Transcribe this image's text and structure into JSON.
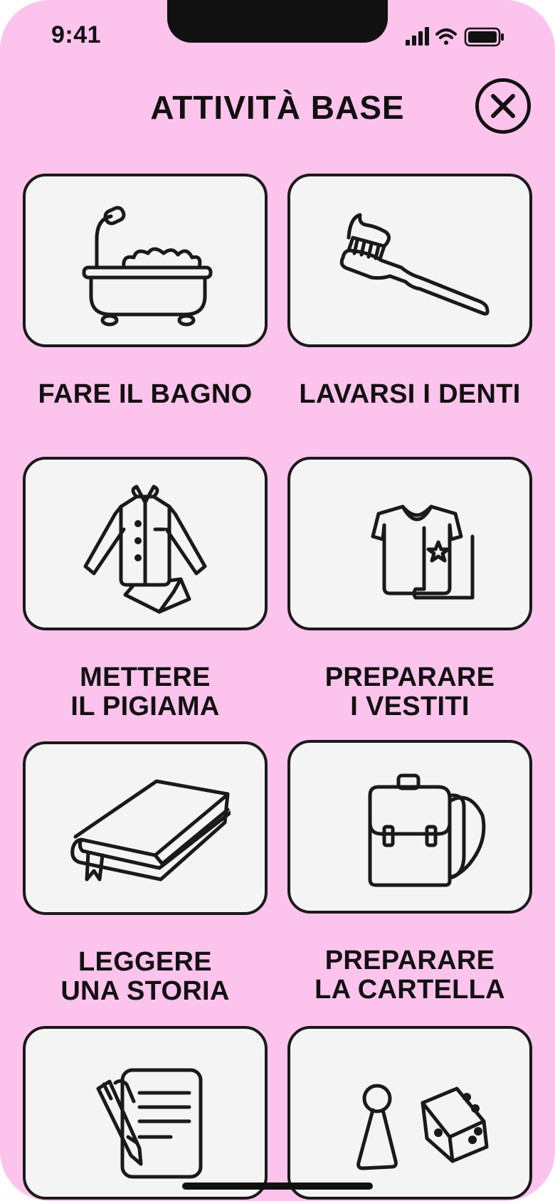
{
  "status_bar": {
    "time": "9:41",
    "icons": [
      "signal-icon",
      "wifi-icon",
      "battery-icon"
    ]
  },
  "header": {
    "title": "ATTIVITÀ BASE",
    "close_icon": "close-icon"
  },
  "activities": [
    {
      "label": "FARE IL BAGNO",
      "icon": "bathtub-icon"
    },
    {
      "label": "LAVARSI I DENTI",
      "icon": "toothbrush-icon"
    },
    {
      "label": "METTERE\nIL PIGIAMA",
      "icon": "pajamas-icon"
    },
    {
      "label": "PREPARARE\nI VESTITI",
      "icon": "clothes-icon"
    },
    {
      "label": "LEGGERE\nUNA STORIA",
      "icon": "book-icon"
    },
    {
      "label": "PREPARARE\nLA CARTELLA",
      "icon": "backpack-icon"
    },
    {
      "label": "",
      "icon": "homework-icon"
    },
    {
      "label": "",
      "icon": "board-game-icon"
    }
  ],
  "colors": {
    "background": "#fcc3ec",
    "card": "#f4f4f4",
    "stroke": "#1a1a1a"
  }
}
